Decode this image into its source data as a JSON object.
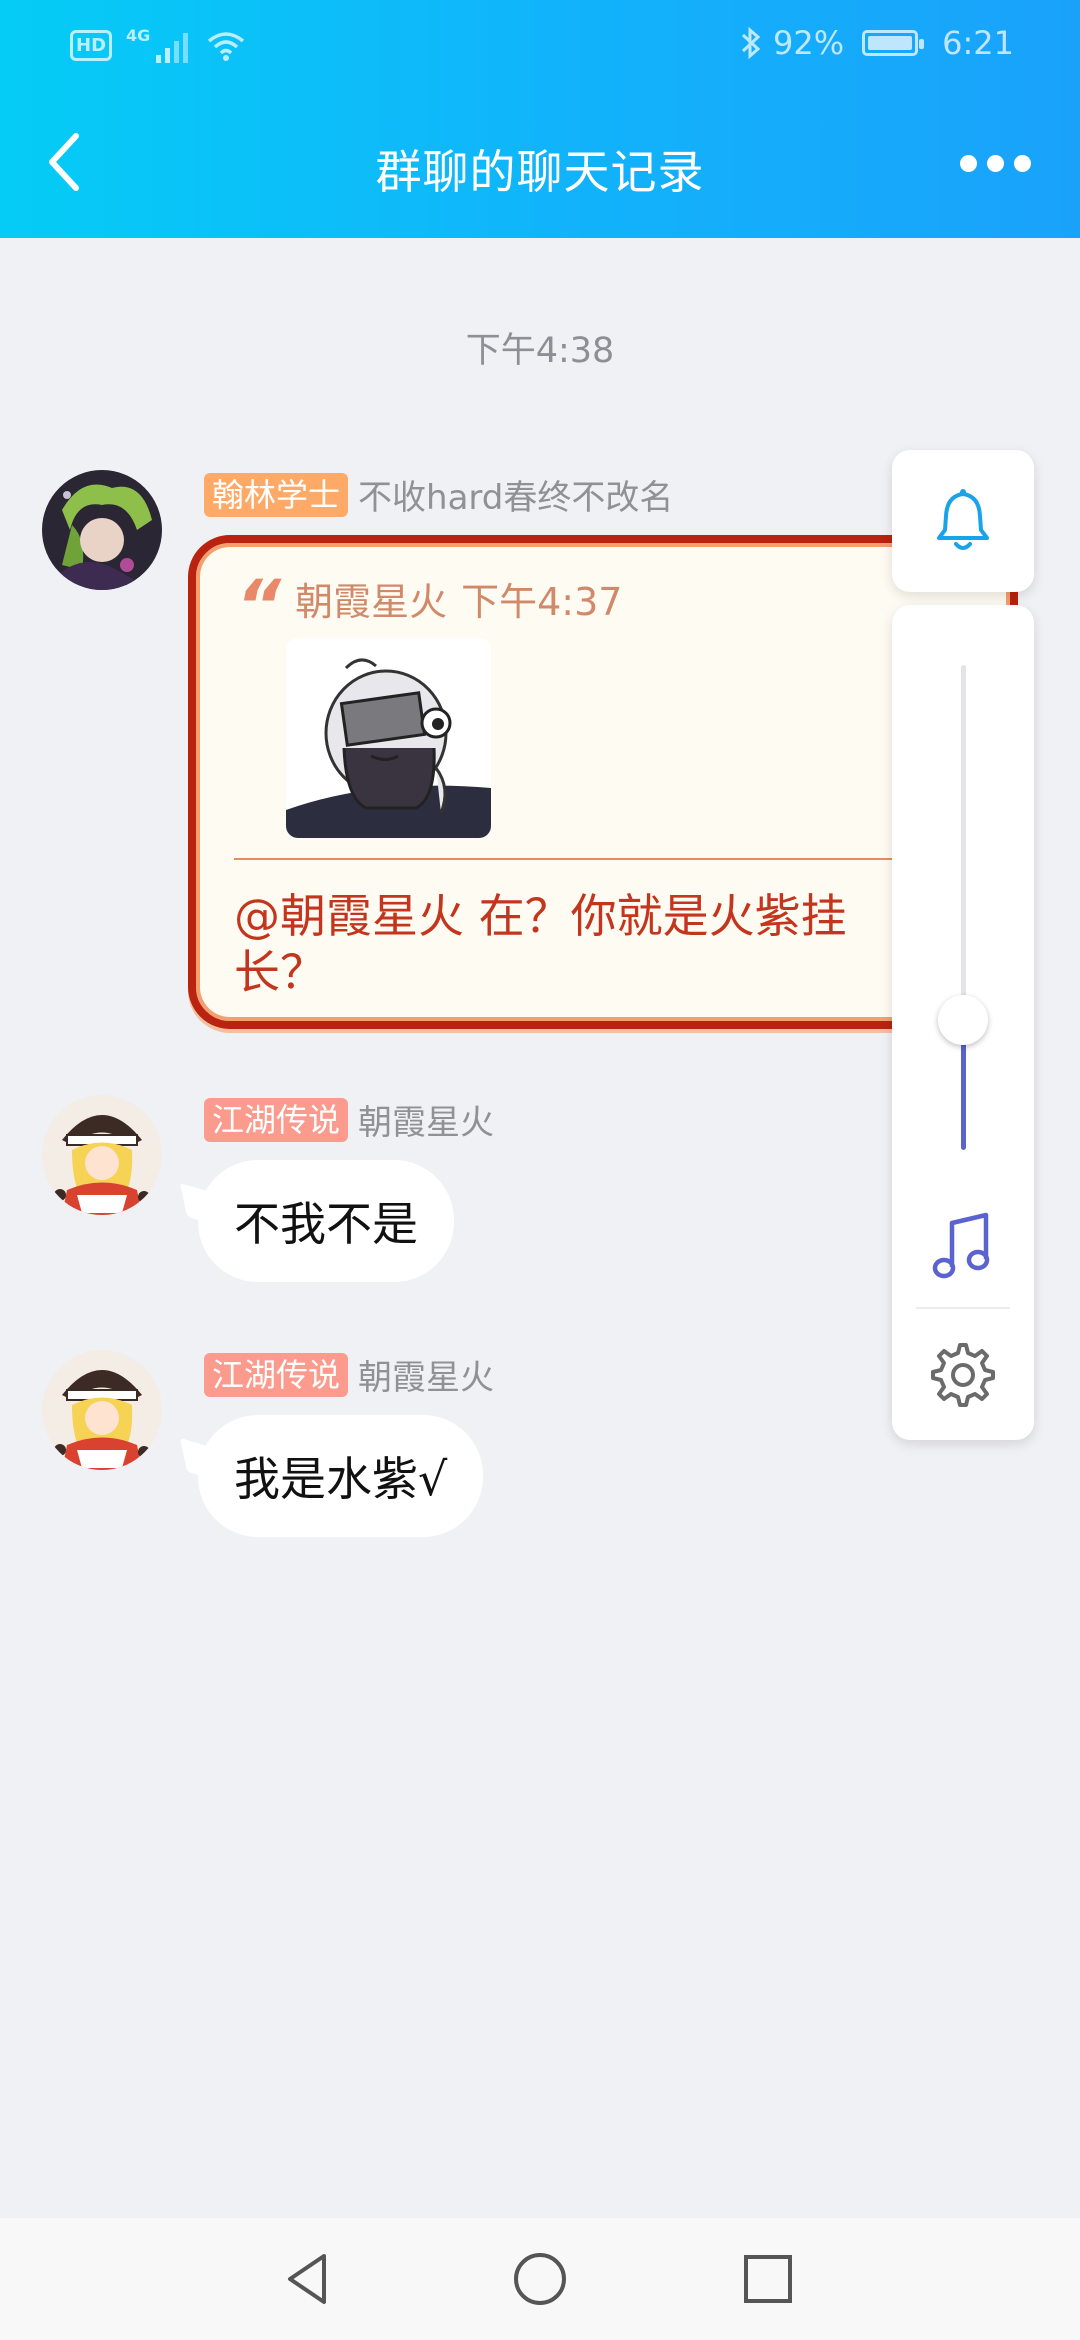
{
  "status_bar": {
    "network_badge": "HD",
    "network_type": "4G",
    "battery": "92%",
    "time": "6:21",
    "icons": [
      "hd-icon",
      "signal-icon",
      "wifi-icon",
      "bluetooth-icon",
      "battery-icon"
    ]
  },
  "header": {
    "title": "群聊的聊天记录",
    "back_icon": "chevron-left-icon",
    "more_icon": "more-dots-icon"
  },
  "chat": {
    "timestamp": "下午4:38",
    "messages": [
      {
        "badge": "翰林学士",
        "badge_color": "#fdaa68",
        "sender": "不收hard春终不改名",
        "type": "quote",
        "quote": {
          "author": "朝霞星火",
          "time": "下午4:37",
          "reply_line1": "@朝霞星火 在？你就是火紫挂",
          "reply_line2": "长？"
        }
      },
      {
        "badge": "江湖传说",
        "badge_color": "#fb9b8e",
        "sender": "朝霞星火",
        "type": "text",
        "text": "不我不是"
      },
      {
        "badge": "江湖传说",
        "badge_color": "#fb9b8e",
        "sender": "朝霞星火",
        "type": "text",
        "text": "我是水紫√"
      }
    ]
  },
  "side_panel": {
    "bell_icon": "bell-icon",
    "music_icon": "music-note-icon",
    "settings_icon": "gear-icon",
    "volume_level": 0.28,
    "accent": "#5b63cf"
  },
  "nav_bar": {
    "icons": [
      "back-triangle-icon",
      "home-circle-icon",
      "recent-square-icon"
    ]
  }
}
